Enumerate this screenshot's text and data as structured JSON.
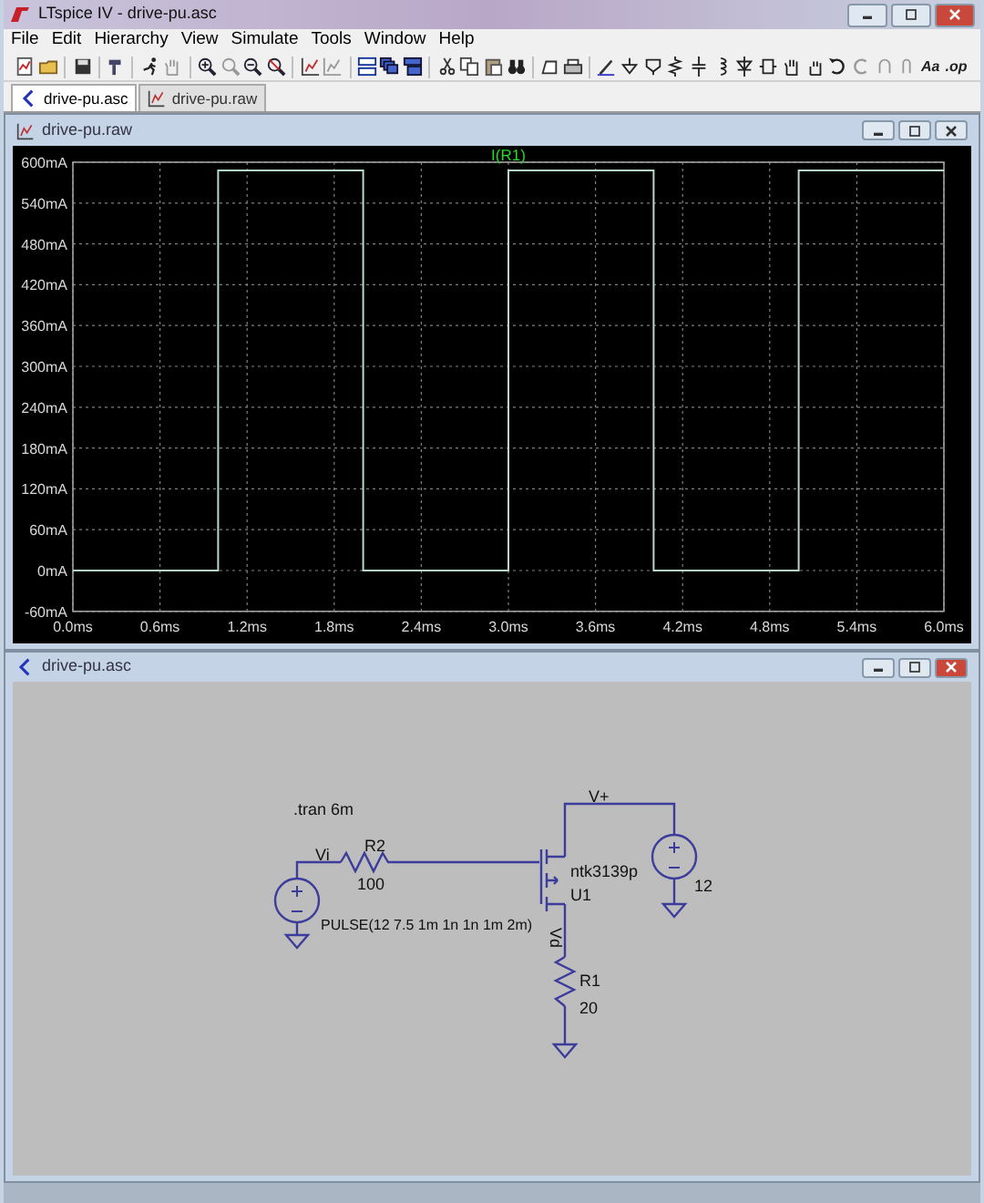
{
  "window": {
    "title": "LTspice IV - drive-pu.asc"
  },
  "menu": [
    {
      "label": "File"
    },
    {
      "label": "Edit"
    },
    {
      "label": "Hierarchy"
    },
    {
      "label": "View"
    },
    {
      "label": "Simulate"
    },
    {
      "label": "Tools"
    },
    {
      "label": "Window"
    },
    {
      "label": "Help"
    }
  ],
  "toolbar_text": [
    "Aa",
    ".op"
  ],
  "tabs": [
    {
      "label": "drive-pu.asc",
      "selected": true,
      "kind": "schematic"
    },
    {
      "label": "drive-pu.raw",
      "selected": false,
      "kind": "waveform"
    }
  ],
  "waveform_window": {
    "title": "drive-pu.raw",
    "chart_data": {
      "type": "line",
      "grid": true,
      "x": [
        0,
        1,
        1,
        2,
        2,
        3,
        3,
        4,
        4,
        5,
        5,
        6
      ],
      "series": [
        {
          "name": "I(R1)",
          "color": "#b8d8c8",
          "values": [
            0,
            0,
            588,
            588,
            0,
            0,
            588,
            588,
            0,
            0,
            588,
            588
          ]
        }
      ],
      "xlim": [
        0,
        6
      ],
      "ylim": [
        -60,
        600
      ],
      "xticks": [
        {
          "value": 0,
          "label": "0.0ms"
        },
        {
          "value": 0.6,
          "label": "0.6ms"
        },
        {
          "value": 1.2,
          "label": "1.2ms"
        },
        {
          "value": 1.8,
          "label": "1.8ms"
        },
        {
          "value": 2.4,
          "label": "2.4ms"
        },
        {
          "value": 3,
          "label": "3.0ms"
        },
        {
          "value": 3.6,
          "label": "3.6ms"
        },
        {
          "value": 4.2,
          "label": "4.2ms"
        },
        {
          "value": 4.8,
          "label": "4.8ms"
        },
        {
          "value": 5.4,
          "label": "5.4ms"
        },
        {
          "value": 6,
          "label": "6.0ms"
        }
      ],
      "yticks": [
        {
          "value": 600,
          "label": "600mA"
        },
        {
          "value": 540,
          "label": "540mA"
        },
        {
          "value": 480,
          "label": "480mA"
        },
        {
          "value": 420,
          "label": "420mA"
        },
        {
          "value": 360,
          "label": "360mA"
        },
        {
          "value": 300,
          "label": "300mA"
        },
        {
          "value": 240,
          "label": "240mA"
        },
        {
          "value": 180,
          "label": "180mA"
        },
        {
          "value": 120,
          "label": "120mA"
        },
        {
          "value": 60,
          "label": "60mA"
        },
        {
          "value": 0,
          "label": "0mA"
        },
        {
          "value": -60,
          "label": "-60mA"
        }
      ]
    }
  },
  "schematic_window": {
    "title": "drive-pu.asc",
    "directive": ".tran 6m",
    "nets": [
      "Vi",
      "V+",
      "Vd"
    ],
    "components": [
      {
        "ref": "R2",
        "value": "100"
      },
      {
        "ref": "U1",
        "value": "ntk3139p"
      },
      {
        "ref": "R1",
        "value": "20"
      }
    ],
    "sources": [
      {
        "value": "PULSE(12 7.5 1m 1n 1n 1m 2m)"
      },
      {
        "value": "12"
      }
    ]
  }
}
